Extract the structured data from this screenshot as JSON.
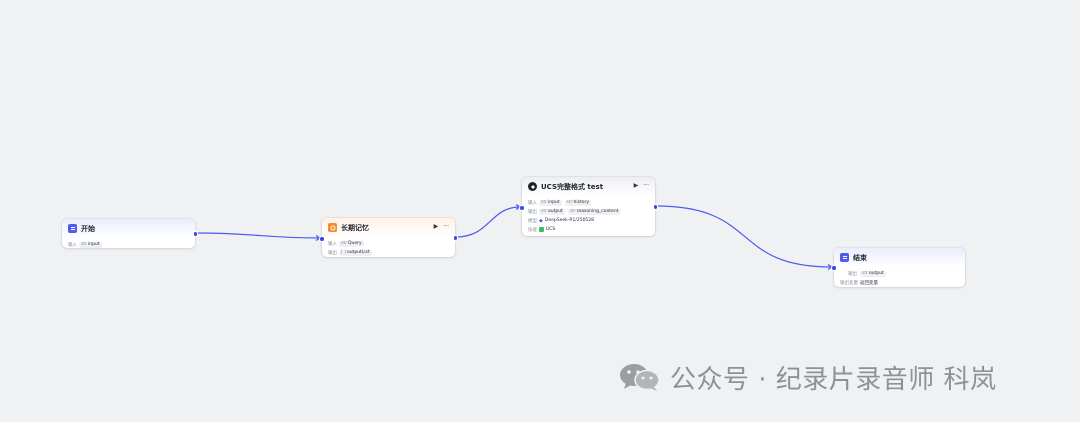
{
  "nodes": {
    "start": {
      "title": "开始",
      "input_label": "输入",
      "input_tag": "input",
      "tag_prefix": "str"
    },
    "memory": {
      "title": "长期记忆",
      "input_label": "输入",
      "input_tag": "Query",
      "output_label": "输出",
      "output_tag": "outputList",
      "tag_prefix": "str",
      "list_prefix": "[ ]"
    },
    "llm": {
      "title": "UCS完整格式 test",
      "input_label": "输入",
      "inputs": [
        "input",
        "history"
      ],
      "output_label": "输出",
      "outputs": [
        "output",
        "reasoning_content"
      ],
      "model_label": "模型",
      "model_value": "DeepSeek-R1/250528",
      "skill_label": "技能",
      "skill_value": "UCS",
      "tag_prefix": "str"
    },
    "end": {
      "title": "结束",
      "output_label": "输出",
      "output_tag": "output",
      "mode_label": "输出变量",
      "mode_value": "返回变量",
      "tag_prefix": "str"
    }
  },
  "actions": {
    "run": "▶",
    "more": "···"
  },
  "colors": {
    "edge": "#4a5bf2",
    "primary": "#4f5cf0",
    "memory": "#f58a2b",
    "canvas": "#f0f1f3"
  },
  "watermark": {
    "text": "公众号 · 纪录片录音师 科岚",
    "icon": "wechat-icon"
  }
}
